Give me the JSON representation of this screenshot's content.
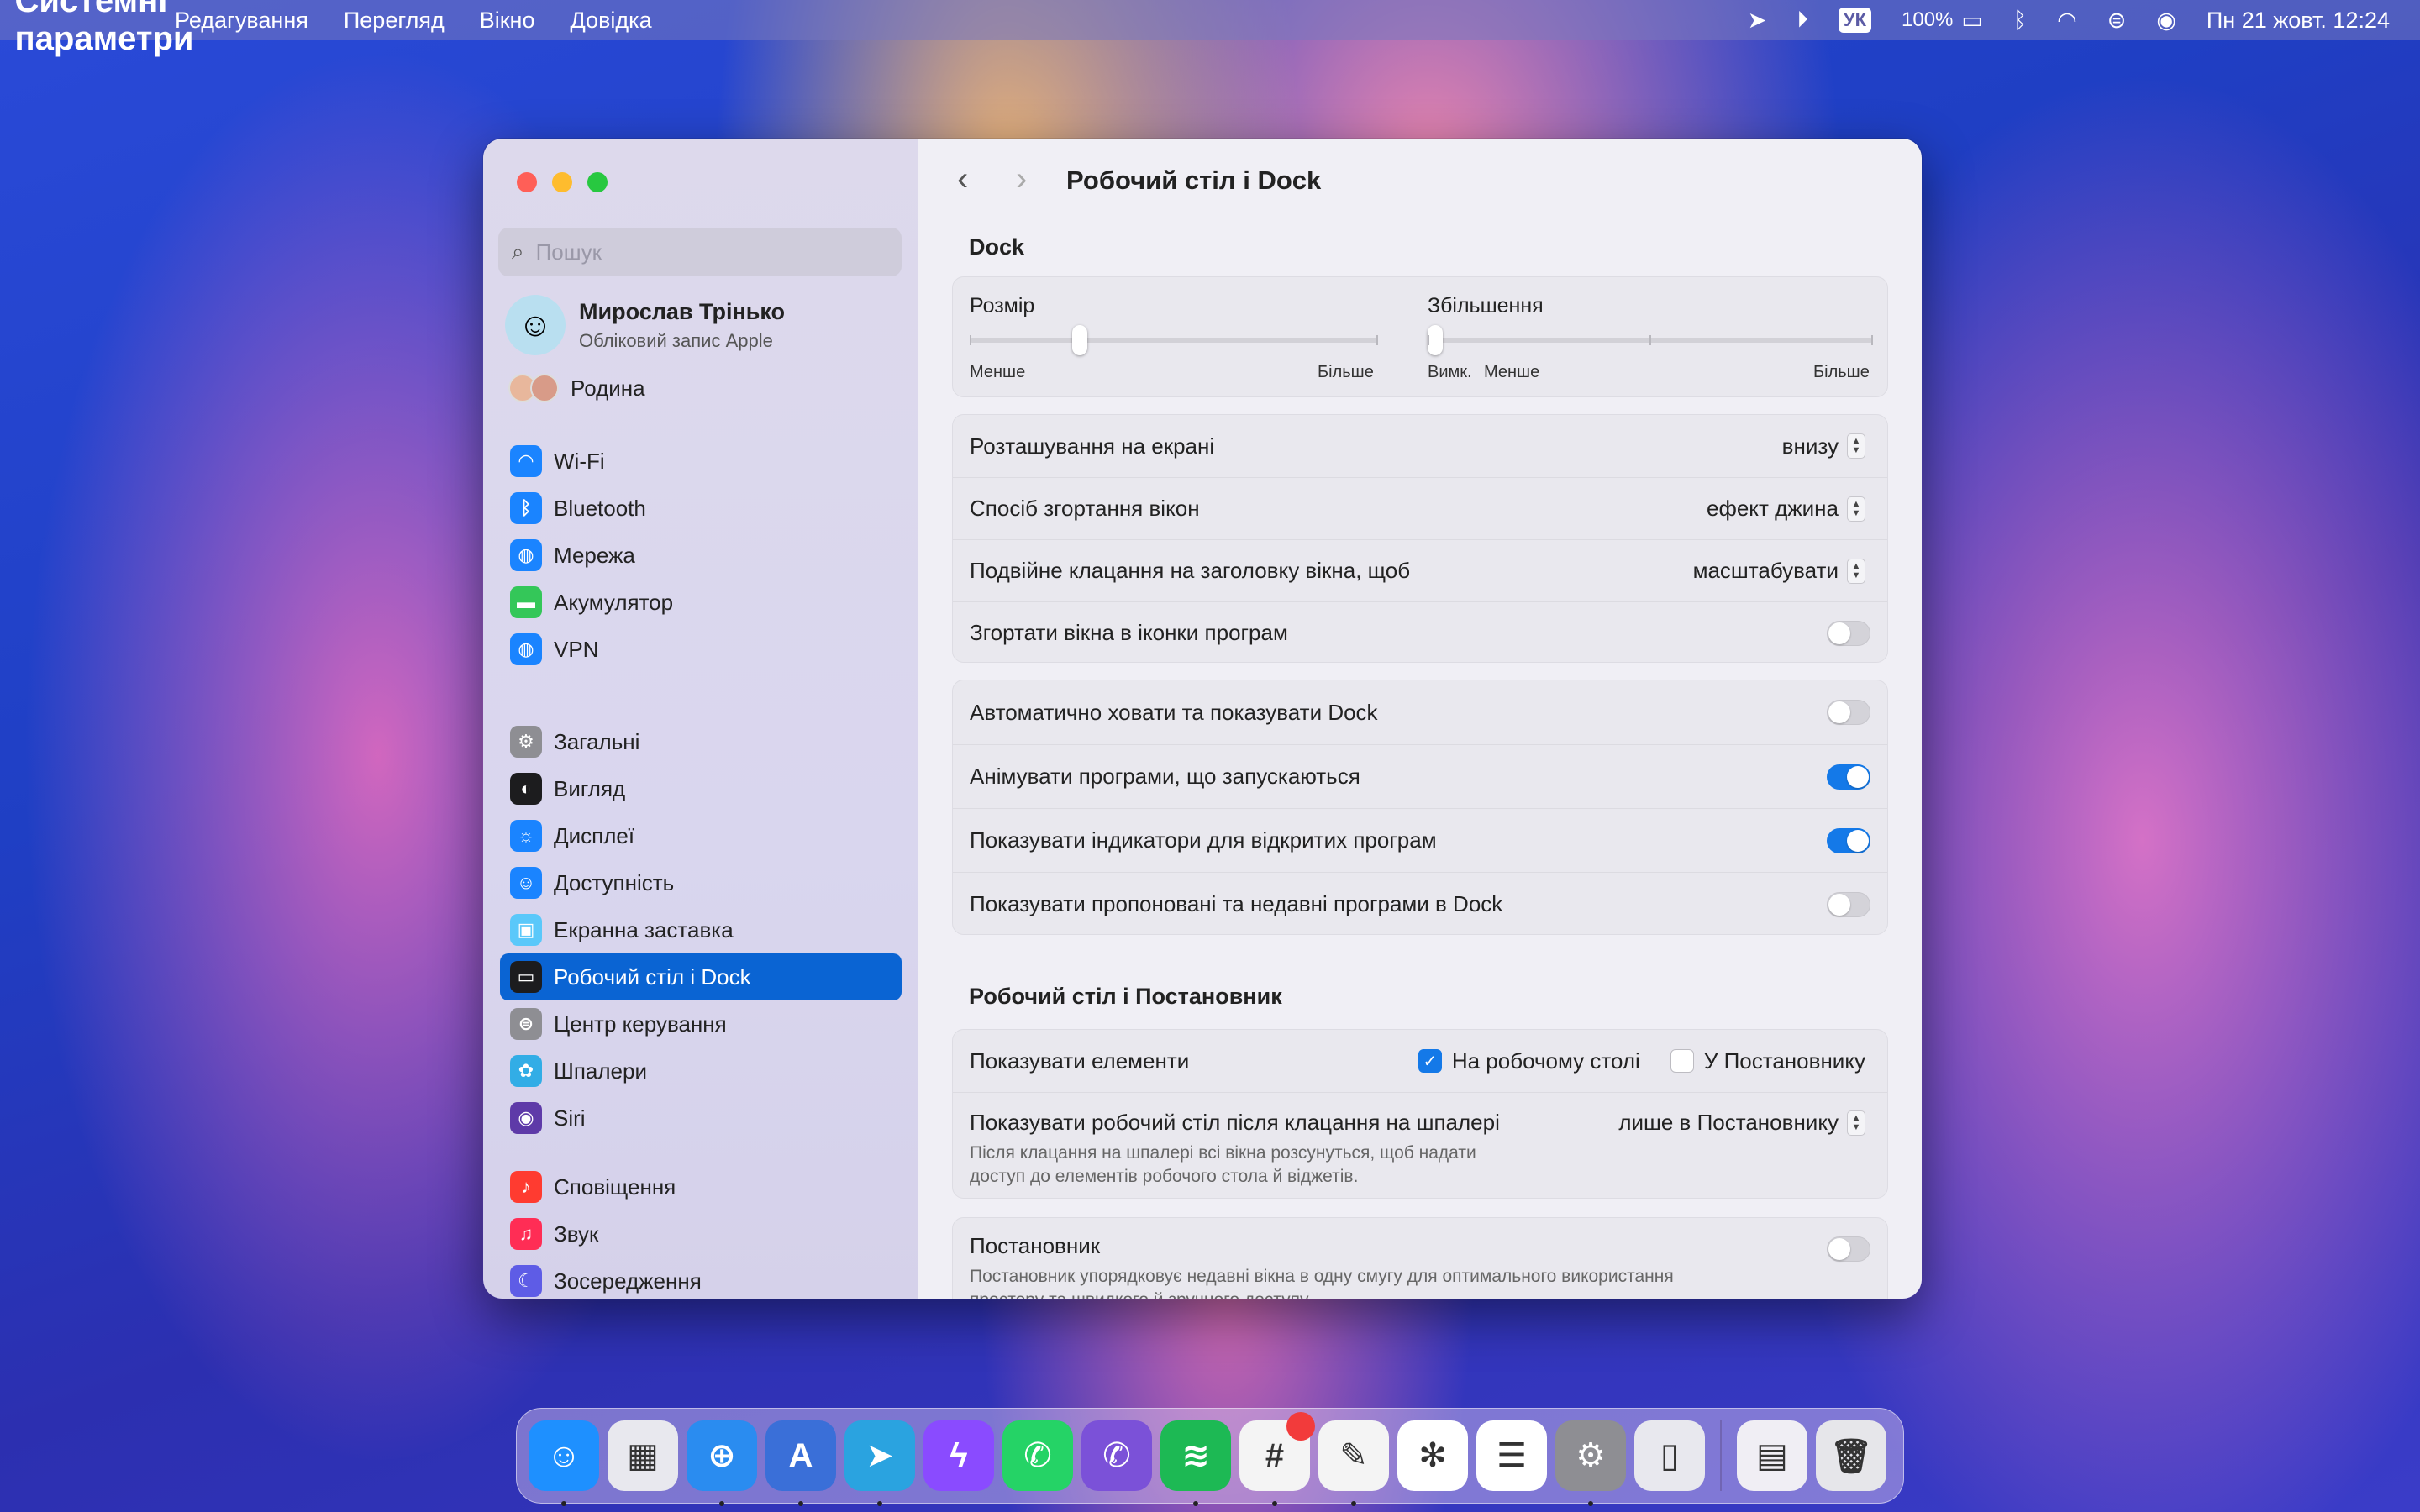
{
  "menubar": {
    "app_name": "Системні параметри",
    "menus": [
      "Редагування",
      "Перегляд",
      "Вікно",
      "Довідка"
    ],
    "lang": "УК",
    "battery": "100%",
    "datetime": "Пн 21 жовт.  12:24"
  },
  "sidebar": {
    "search_placeholder": "Пошук",
    "account_name": "Мирослав Трінько",
    "account_sub": "Обліковий запис Apple",
    "family": "Родина",
    "group1": [
      {
        "label": "Wi-Fi",
        "icon": "wifi-icon",
        "color": "#1a84ff"
      },
      {
        "label": "Bluetooth",
        "icon": "bluetooth-icon",
        "color": "#1a84ff"
      },
      {
        "label": "Мережа",
        "icon": "globe-icon",
        "color": "#1a84ff"
      },
      {
        "label": "Акумулятор",
        "icon": "battery-icon",
        "color": "#34c759"
      },
      {
        "label": "VPN",
        "icon": "vpn-icon",
        "color": "#1a84ff"
      }
    ],
    "group2": [
      {
        "label": "Загальні",
        "icon": "gear-icon",
        "color": "#8e8e93"
      },
      {
        "label": "Вигляд",
        "icon": "appearance-icon",
        "color": "#1c1c1e"
      },
      {
        "label": "Дисплеї",
        "icon": "sun-icon",
        "color": "#1a84ff"
      },
      {
        "label": "Доступність",
        "icon": "accessibility-icon",
        "color": "#1a84ff"
      },
      {
        "label": "Екранна заставка",
        "icon": "screensaver-icon",
        "color": "#5ac8fa"
      },
      {
        "label": "Робочий стіл і Dock",
        "icon": "dock-icon",
        "color": "#1c1c1e",
        "selected": true
      },
      {
        "label": "Центр керування",
        "icon": "control-center-icon",
        "color": "#8e8e93"
      },
      {
        "label": "Шпалери",
        "icon": "flower-icon",
        "color": "#32ade6"
      },
      {
        "label": "Siri",
        "icon": "siri-icon",
        "color": "#5e3aa8"
      }
    ],
    "group3": [
      {
        "label": "Сповіщення",
        "icon": "bell-icon",
        "color": "#ff3b30"
      },
      {
        "label": "Звук",
        "icon": "speaker-icon",
        "color": "#ff2d55"
      },
      {
        "label": "Зосередження",
        "icon": "moon-icon",
        "color": "#5e5ce6"
      }
    ]
  },
  "main": {
    "title": "Робочий стіл і Dock",
    "dock_heading": "Dock",
    "size": {
      "label": "Розмір",
      "min": "Менше",
      "max": "Більше",
      "value": 0.27
    },
    "magnification": {
      "label": "Збільшення",
      "off": "Вимк.",
      "min": "Менше",
      "max": "Більше",
      "value": 0.0
    },
    "position": {
      "label": "Розташування на екрані",
      "value": "внизу"
    },
    "minimize": {
      "label": "Спосіб згортання вікон",
      "value": "ефект джина"
    },
    "double_click": {
      "label": "Подвійне клацання на заголовку вікна, щоб",
      "value": "масштабувати"
    },
    "minimize_into_icon": {
      "label": "Згортати вікна в іконки програм",
      "on": false
    },
    "autohide": {
      "label": "Автоматично ховати та показувати Dock",
      "on": false
    },
    "animate": {
      "label": "Анімувати програми, що запускаються",
      "on": true
    },
    "indicators": {
      "label": "Показувати індикатори для відкритих програм",
      "on": true
    },
    "recent": {
      "label": "Показувати пропоновані та недавні програми в Dock",
      "on": false
    },
    "desktop_heading": "Робочий стіл і Постановник",
    "show_items": {
      "label": "Показувати елементи",
      "desktop": "На робочому столі",
      "desktop_on": true,
      "stage": "У Постановнику",
      "stage_on": false
    },
    "click_wallpaper": {
      "label": "Показувати робочий стіл після клацання на шпалері",
      "value": "лише в Постановнику",
      "desc1": "Після клацання на шпалері всі вікна розсунуться, щоб надати",
      "desc2": "доступ до елементів робочого стола й віджетів."
    },
    "stage_manager": {
      "label": "Постановник",
      "on": false,
      "desc1": "Постановник упорядковує недавні вікна в одну смугу для оптимального використання",
      "desc2": "простору та швидкого й зручного доступу."
    }
  },
  "dock": [
    {
      "name": "finder",
      "color": "#1e90ff",
      "glyph": "☺",
      "running": true
    },
    {
      "name": "launchpad",
      "color": "#e8e8ee",
      "glyph": "▦",
      "running": false
    },
    {
      "name": "safari",
      "color": "#2a8cf0",
      "glyph": "⊕",
      "running": true
    },
    {
      "name": "xcode-like",
      "color": "#3a6fd8",
      "glyph": "A",
      "running": true
    },
    {
      "name": "telegram",
      "color": "#2aa3e0",
      "glyph": "➤",
      "running": true
    },
    {
      "name": "messenger",
      "color": "#8a4bff",
      "glyph": "ϟ",
      "running": false
    },
    {
      "name": "whatsapp",
      "color": "#25d366",
      "glyph": "✆",
      "running": false
    },
    {
      "name": "viber",
      "color": "#7b51d8",
      "glyph": "✆",
      "running": false
    },
    {
      "name": "spotify",
      "color": "#1db954",
      "glyph": "≋",
      "running": true
    },
    {
      "name": "slack",
      "color": "#f4f4f4",
      "glyph": "#",
      "running": true,
      "badge": true
    },
    {
      "name": "pixelmator",
      "color": "#f4f4f4",
      "glyph": "✎",
      "running": true
    },
    {
      "name": "chatgpt",
      "color": "#ffffff",
      "glyph": "✻",
      "running": false
    },
    {
      "name": "reminders",
      "color": "#ffffff",
      "glyph": "☰",
      "running": false
    },
    {
      "name": "system-settings",
      "color": "#8e8e93",
      "glyph": "⚙",
      "running": true
    },
    {
      "name": "iphone-mirroring",
      "color": "#e8e8ee",
      "glyph": "▯",
      "running": false
    }
  ],
  "dock_right": [
    {
      "name": "downloads-stack",
      "color": "#f0eef4",
      "glyph": "▤"
    },
    {
      "name": "trash",
      "color": "#e6e6ea",
      "glyph": "🗑"
    }
  ]
}
